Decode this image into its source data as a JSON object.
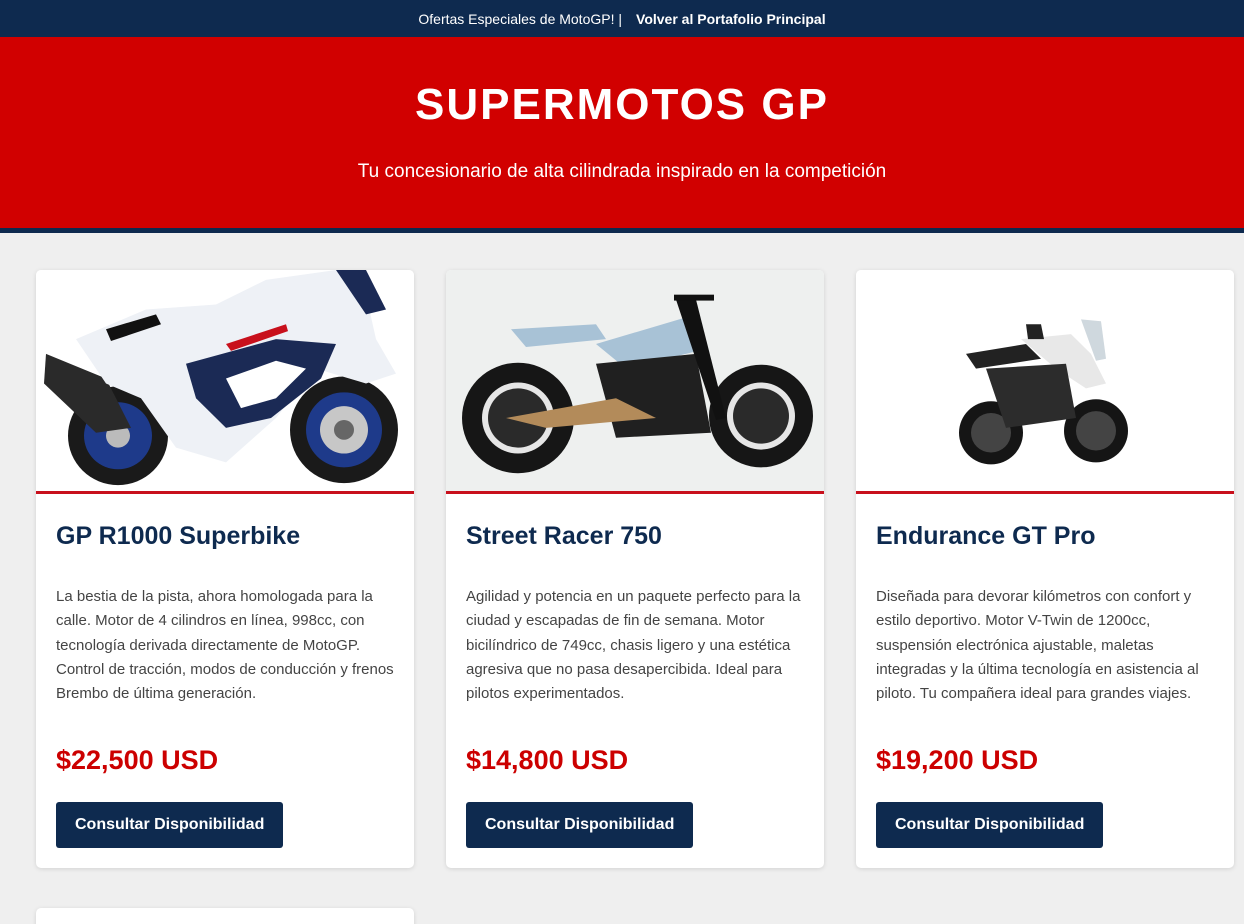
{
  "topbar": {
    "promo": "Ofertas Especiales de MotoGP! |",
    "back_link": "Volver al Portafolio Principal"
  },
  "hero": {
    "title": "SUPERMOTOS GP",
    "subtitle": "Tu concesionario de alta cilindrada inspirado en la competición"
  },
  "products": [
    {
      "name": "GP R1000 Superbike",
      "description": "La bestia de la pista, ahora homologada para la calle. Motor de 4 cilindros en línea, 998cc, con tecnología derivada directamente de MotoGP. Control de tracción, modos de conducción y frenos Brembo de última generación.",
      "price": "$22,500 USD",
      "button": "Consultar Disponibilidad",
      "image": "sport-superbike-white-blue"
    },
    {
      "name": "Street Racer 750",
      "description": "Agilidad y potencia en un paquete perfecto para la ciudad y escapadas de fin de semana. Motor bicilíndrico de 749cc, chasis ligero y una estética agresiva que no pasa desapercibida. Ideal para pilotos experimentados.",
      "price": "$14,800 USD",
      "button": "Consultar Disponibilidad",
      "image": "cafe-racer-light-blue"
    },
    {
      "name": "Endurance GT Pro",
      "description": "Diseñada para devorar kilómetros con confort y estilo deportivo. Motor V-Twin de 1200cc, suspensión electrónica ajustable, maletas integradas y la última tecnología en asistencia al piloto. Tu compañera ideal para grandes viajes.",
      "price": "$19,200 USD",
      "button": "Consultar Disponibilidad",
      "image": "adventure-touring-white"
    }
  ],
  "colors": {
    "navy": "#0e2a4f",
    "hero_red": "#d10000",
    "price_red": "#cc0000",
    "accent_line": "#c8101c",
    "background": "#efefef"
  }
}
